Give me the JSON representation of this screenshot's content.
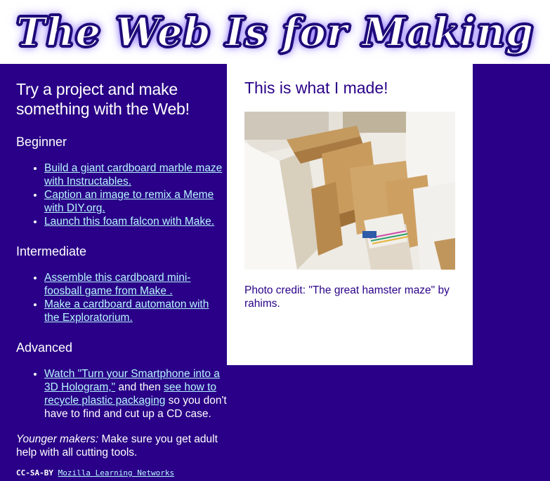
{
  "header": {
    "title": "The Web Is for Making"
  },
  "sidebar": {
    "heading": "Try a project and make something with the Web!",
    "beginner": {
      "heading": "Beginner",
      "items": [
        {
          "link": "Build a giant cardboard marble maze with Instructables."
        },
        {
          "link": "Caption an image to remix a Meme with DIY.org."
        },
        {
          "link": "Launch this foam falcon with Make."
        }
      ]
    },
    "intermediate": {
      "heading": "Intermediate",
      "items": [
        {
          "link": "Assemble this cardboard mini-foosball game from Make ."
        },
        {
          "link": "Make a cardboard automaton with the Exploratorium."
        }
      ]
    },
    "advanced": {
      "heading": "Advanced",
      "item": {
        "link1": "Watch \"Turn your Smartphone into a 3D Hologram,\"",
        "text1": " and then ",
        "link2": "see how to recycle plastic packaging",
        "text2": " so you don't have to find and cut up a CD case."
      }
    },
    "younger": {
      "label": "Younger makers:",
      "text": " Make sure you get adult help with all cutting tools."
    },
    "license": {
      "prefix": "CC-SA-BY ",
      "link": "Mozilla Learning Networks"
    }
  },
  "panel": {
    "heading": "This is what I made!",
    "photo_alt": "The great hamster maze",
    "credit": "Photo credit: \"The great hamster maze\" by rahims."
  },
  "colors": {
    "background": "#290087",
    "link": "#b7f7ff",
    "panel_text": "#290087",
    "header_bg": "#ffffff"
  }
}
